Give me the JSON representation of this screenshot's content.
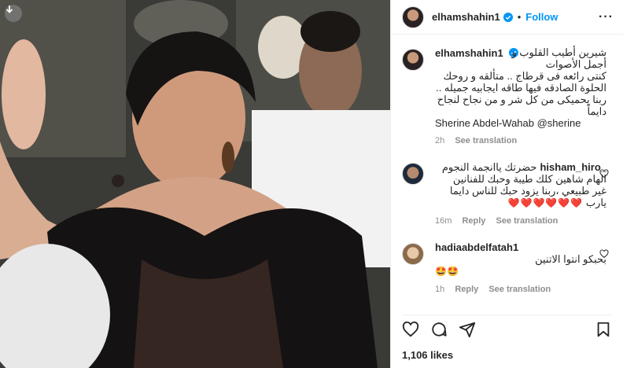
{
  "post": {
    "username": "elhamshahin1",
    "follow_label": "Follow",
    "separator": "•",
    "more_label": "···",
    "likes": "1,106 likes"
  },
  "caption": {
    "username": "elhamshahin1",
    "lines": [
      "شيرين أطيب القلوب و",
      "أجمل الأصوات",
      "كنتى رائعه فى قرطاج .. متألقه و روحك",
      "الحلوة الصادقه فيها طاقه ايجابيه جميله ..",
      "ربنا يحميكى من كل شر و من نجاح لنجاح",
      "دايماً"
    ],
    "mentions": "Sherine Abdel-Wahab @sherine",
    "time": "2h",
    "see_translation": "See translation"
  },
  "comments": [
    {
      "username": "_hisham_hiro",
      "lines": [
        "حضرتك ياانجمة النجوم",
        "الهام شاهين كلك طيبة وحبك للفنانين",
        "غير طبيعي ،ربنا يزود حبك للناس دايما",
        "يارب"
      ],
      "hearts": "❤️❤️❤️❤️❤️❤️",
      "time": "16m",
      "reply": "Reply",
      "see_translation": "See translation"
    },
    {
      "username": "hadiaabdelfatah1",
      "text": "بحبكو انتوا الاتنين",
      "emojis": "🤩🤩",
      "time": "1h",
      "reply": "Reply",
      "see_translation": "See translation"
    }
  ],
  "icons": {
    "download": "download-icon",
    "heart": "heart-icon",
    "comment": "comment-icon",
    "share": "share-icon",
    "save": "bookmark-icon"
  },
  "colors": {
    "accent": "#0095f6",
    "verified": "#0095f6",
    "meta": "#8e8e8e"
  }
}
